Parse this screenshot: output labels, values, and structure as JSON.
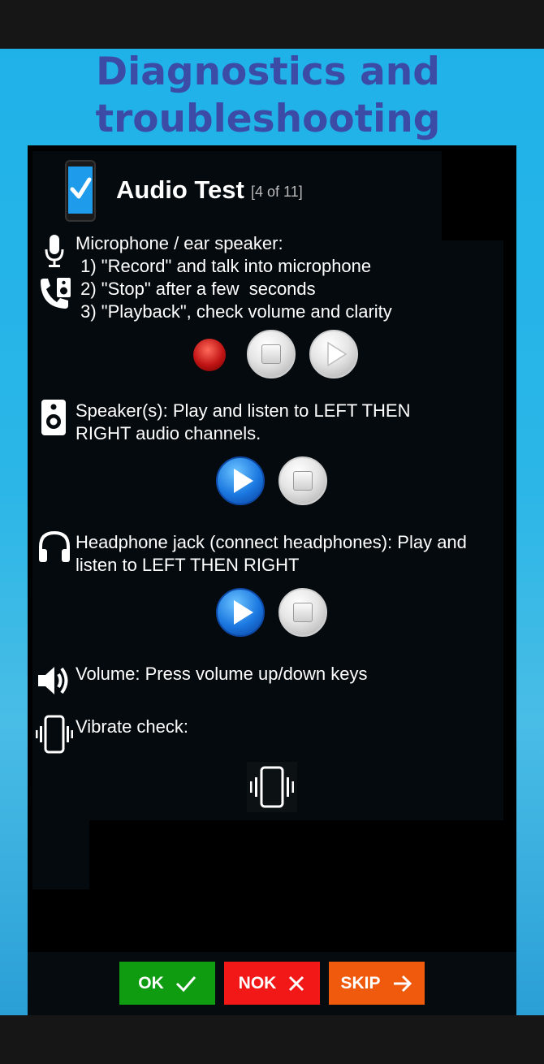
{
  "headline": {
    "line1": "Diagnostics and",
    "line2": "troubleshooting"
  },
  "test": {
    "title": "Audio Test",
    "counter": "[4 of 11]"
  },
  "microphone": {
    "heading": "Microphone / ear speaker:",
    "step1": " 1) \"Record\" and talk into microphone",
    "step2": " 2) \"Stop\" after a few  seconds",
    "step3": " 3) \"Playback\", check volume and clarity"
  },
  "speaker": {
    "line1": "Speaker(s): Play and listen to LEFT THEN",
    "line2": "RIGHT audio channels."
  },
  "headphone": {
    "line1": "Headphone jack (connect headphones): Play and",
    "line2": "listen to LEFT THEN RIGHT"
  },
  "volume": {
    "text": "Volume: Press volume up/down keys"
  },
  "vibrate": {
    "text": "Vibrate check:"
  },
  "actions": {
    "ok": "OK",
    "nok": "NOK",
    "skip": "SKIP"
  },
  "colors": {
    "background_blue": "#2bb6e7",
    "headline": "#3c4ba6",
    "ok": "#109c10",
    "nok": "#f21818",
    "skip": "#ef5a0c"
  },
  "icons": {
    "title": "phone-check-icon",
    "microphone": "microphone-icon",
    "ear_speaker": "phone-speaker-icon",
    "speaker": "speaker-icon",
    "headphone": "headphones-icon",
    "volume": "volume-icon",
    "vibrate": "vibrate-icon"
  }
}
